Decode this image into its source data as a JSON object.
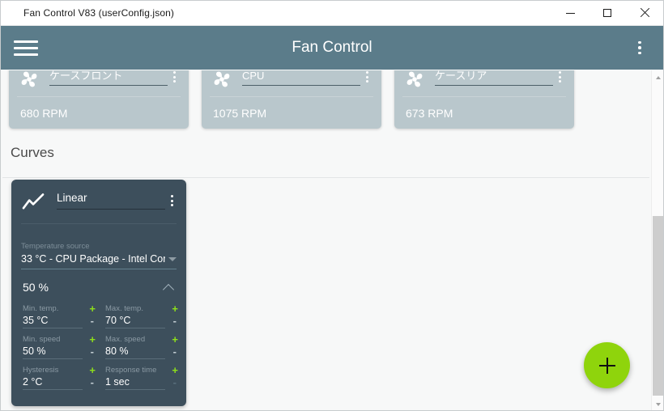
{
  "titlebar": {
    "text": "Fan Control V83 (userConfig.json)",
    "minimize_label": "Minimize",
    "maximize_label": "Maximize",
    "close_label": "Close"
  },
  "header": {
    "title": "Fan Control",
    "menu_icon": "hamburger-menu-icon",
    "overflow_icon": "kebab-menu-icon"
  },
  "colors": {
    "header_bg": "#5b7c8a",
    "card_bg": "#b9c7cc",
    "curve_card_bg": "#3d4f5c",
    "accent_green": "#8fd40c",
    "stepper_plus": "#8fe01a",
    "page_bg": "#f7f8f8"
  },
  "fans": [
    {
      "name": "ケースフロント",
      "rpm": "680 RPM",
      "icon": "fan-icon",
      "menu_icon": "kebab-menu-icon"
    },
    {
      "name": "CPU",
      "rpm": "1075 RPM",
      "icon": "fan-icon",
      "menu_icon": "kebab-menu-icon"
    },
    {
      "name": "ケースリア",
      "rpm": "673 RPM",
      "icon": "fan-icon",
      "menu_icon": "kebab-menu-icon"
    }
  ],
  "curves_section": {
    "title": "Curves"
  },
  "curve_card": {
    "icon": "line-chart-icon",
    "name": "Linear",
    "menu_icon": "kebab-menu-icon",
    "temperature_source_label": "Temperature source",
    "temperature_source_value": "33 °C - CPU Package - Intel Cor",
    "dropdown_icon": "chevron-down-icon",
    "current_percent": "50 %",
    "collapse_icon": "chevron-up-icon",
    "params": [
      {
        "label": "Min. temp.",
        "value": "35 °C",
        "plus": "+",
        "minus": "-",
        "minus_disabled": false
      },
      {
        "label": "Max. temp.",
        "value": "70 °C",
        "plus": "+",
        "minus": "-",
        "minus_disabled": false
      },
      {
        "label": "Min. speed",
        "value": "50 %",
        "plus": "+",
        "minus": "-",
        "minus_disabled": false
      },
      {
        "label": "Max. speed",
        "value": "80 %",
        "plus": "+",
        "minus": "-",
        "minus_disabled": false
      },
      {
        "label": "Hysteresis",
        "value": "2 °C",
        "plus": "+",
        "minus": "-",
        "minus_disabled": false
      },
      {
        "label": "Response time",
        "value": "1 sec",
        "plus": "+",
        "minus": "-",
        "minus_disabled": true
      }
    ]
  },
  "fab": {
    "icon": "plus-icon",
    "label": "Add"
  },
  "scrollbar": {
    "up_icon": "arrow-up-icon",
    "down_icon": "arrow-down-icon",
    "thumb": "scrollbar-thumb"
  }
}
